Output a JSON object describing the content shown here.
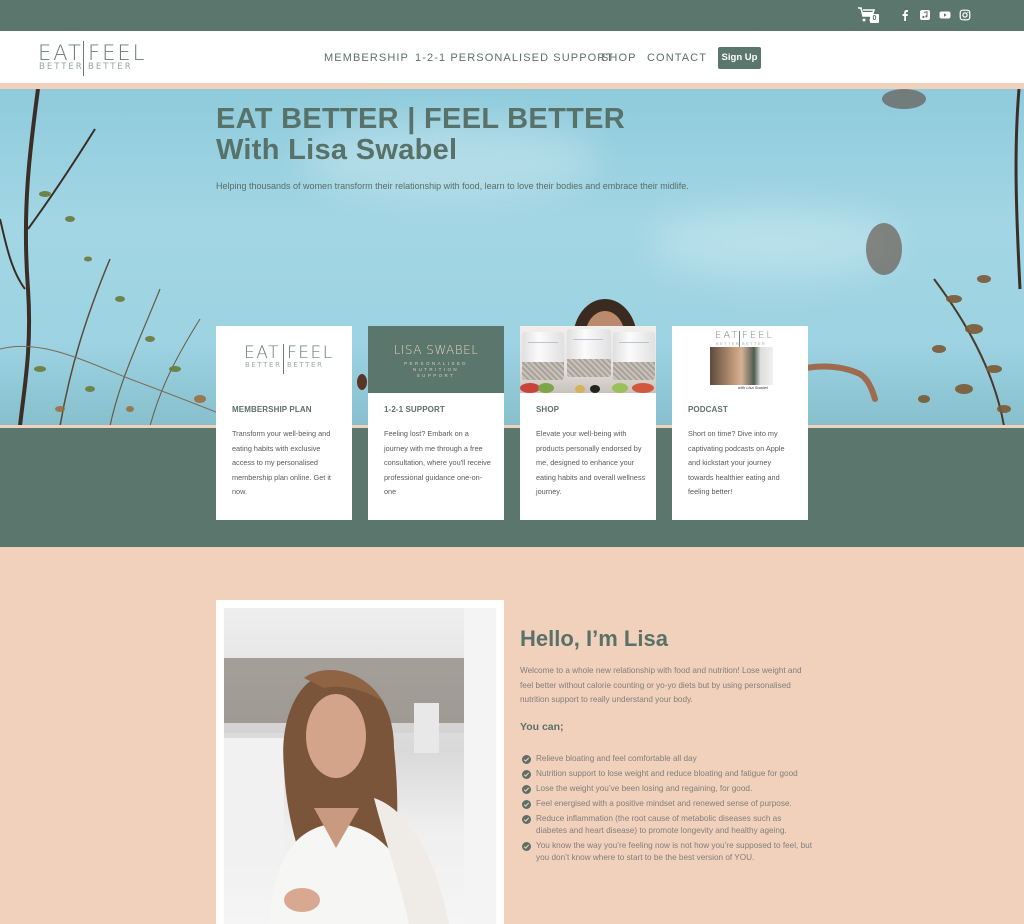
{
  "topbar": {
    "cart_count": "0",
    "icons": [
      "shopping-cart-icon",
      "facebook-icon",
      "apple-podcasts-icon",
      "youtube-icon",
      "instagram-icon"
    ]
  },
  "header": {
    "logo": {
      "top": "EATFEEL",
      "top_left": "EAT",
      "top_right": "FEEL",
      "bottom_left": "BETTER",
      "bottom_right": "BETTER"
    },
    "nav": [
      {
        "label": "MEMBERSHIP"
      },
      {
        "label": "1-2-1 PERSONALISED SUPPORT"
      },
      {
        "label": "SHOP"
      },
      {
        "label": "CONTACT"
      }
    ],
    "signup_label": "Sign Up"
  },
  "hero": {
    "title_line1": "EAT BETTER | FEEL BETTER",
    "title_line2": "With Lisa Swabel",
    "subtitle": "Helping thousands of women transform their relationship with food, learn to love their bodies and embrace their midlife."
  },
  "cards": [
    {
      "title": "MEMBERSHIP PLAN",
      "description": "Transform your well-being and eating habits with exclusive access to my personalised membership plan online. Get it now.",
      "image": {
        "logo_top_left": "EAT",
        "logo_top_right": "FEEL",
        "logo_bottom_left": "BETTER",
        "logo_bottom_right": "BETTER"
      }
    },
    {
      "title": "1-2-1 SUPPORT",
      "description": "Feeling lost? Embark on a journey with me through a free consultation, where you'll receive professional guidance one-on-one",
      "image": {
        "name": "LISA SWABEL",
        "line1": "PERSONALISED",
        "line2": "NUTRITION",
        "line3": "SUPPORT"
      }
    },
    {
      "title": "SHOP",
      "description": "Elevate your well-being with products personally endorsed by me, designed to enhance your eating habits and overall wellness journey."
    },
    {
      "title": "PODCAST",
      "description": "Short on time? Dive into my captivating podcasts on Apple and kickstart your journey towards healthier eating and feeling better!",
      "image": {
        "logo_top_left": "EAT",
        "logo_top_right": "FEEL",
        "logo_bottom_left": "BETTER",
        "logo_bottom_right": "BETTER",
        "caption": "with Lisa Swabel"
      }
    }
  ],
  "about": {
    "title": "Hello, I’m Lisa",
    "intro": "Welcome to a whole new relationship with food and nutrition! Lose weight and feel better without calorie counting or yo-yo diets but by using personalised nutrition support to really understand your body.",
    "you_can": "You can;",
    "bullets": [
      "Relieve bloating and feel comfortable all day",
      "Nutrition support to lose weight and reduce bloating and fatigue for good",
      "Lose the weight you’ve been losing and regaining, for good.",
      "Feel energised with a positive mindset and renewed sense of purpose.",
      "Reduce inflammation (the root cause of metabolic diseases such as diabetes and heart disease) to promote longevity and healthy ageing.",
      "You know the way you’re feeling now is not how you’re supposed to feel, but you don’t know where to start to be the best version of YOU."
    ]
  },
  "colors": {
    "brand_green": "#5b766d",
    "peach": "#f2d1bc",
    "heading_green": "#587169",
    "white": "#ffffff"
  }
}
